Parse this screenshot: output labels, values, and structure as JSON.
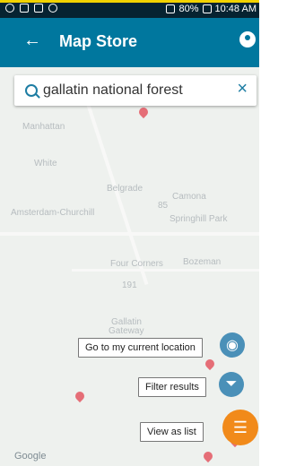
{
  "status": {
    "battery": "80%",
    "time": "10:48 AM"
  },
  "header": {
    "title": "Map Store",
    "back_icon": "←",
    "account_icon": "person-circle-icon"
  },
  "search": {
    "value": "gallatin national forest",
    "clear_icon": "×"
  },
  "map": {
    "labels": [
      "Manhattan",
      "White",
      "Belgrade",
      "Camona",
      "Amsterdam-Churchill",
      "Springhill Park",
      "Four Corners",
      "Bozeman",
      "Gallatin",
      "Gateway",
      "191",
      "85"
    ],
    "attribution": "Google"
  },
  "actions": {
    "current_location": "Go to my current location",
    "filter_results": "Filter results",
    "view_as_list": "View as list"
  },
  "colors": {
    "accent": "#00779e",
    "fab_blue": "#4a90b8",
    "fab_orange": "#f18a1a",
    "map_pin": "#e56e77"
  }
}
